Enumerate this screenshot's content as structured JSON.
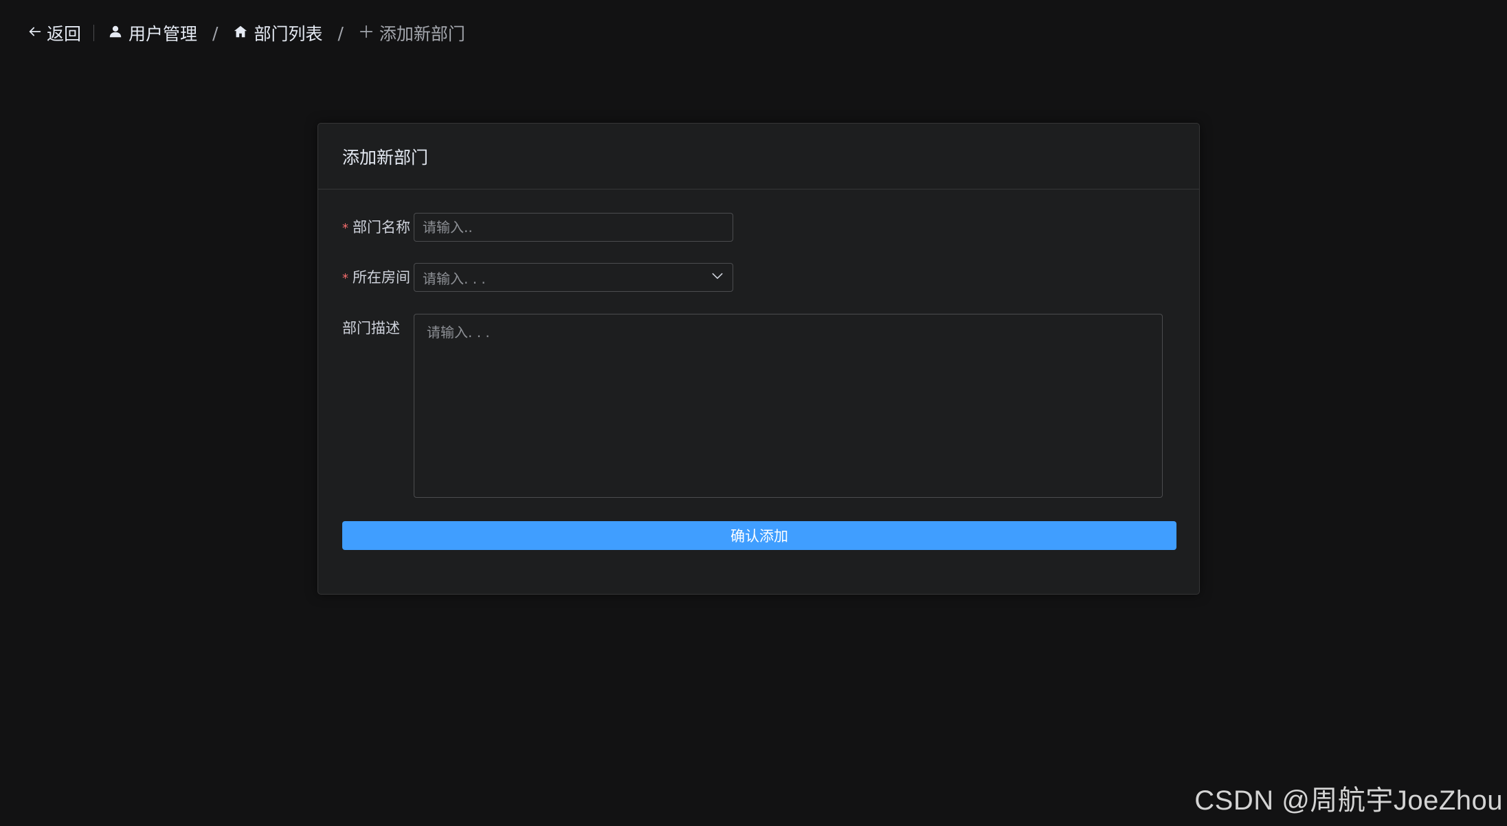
{
  "header": {
    "back_label": "返回",
    "breadcrumbs": [
      {
        "label": "用户管理",
        "icon": "user-icon"
      },
      {
        "label": "部门列表",
        "icon": "home-icon"
      },
      {
        "label": "添加新部门",
        "icon": "plus-icon"
      }
    ],
    "separator": "/"
  },
  "card": {
    "title": "添加新部门"
  },
  "form": {
    "dept_name": {
      "label": "部门名称",
      "required": true,
      "value": "",
      "placeholder": "请输入.."
    },
    "room": {
      "label": "所在房间",
      "required": true,
      "placeholder": "请输入. . ."
    },
    "description": {
      "label": "部门描述",
      "required": false,
      "value": "",
      "placeholder": "请输入. . ."
    },
    "submit_label": "确认添加"
  },
  "watermark": "CSDN @周航宇JoeZhou",
  "colors": {
    "background": "#121213",
    "card": "#1d1e1f",
    "primary": "#409eff",
    "required": "#f56c6c"
  }
}
